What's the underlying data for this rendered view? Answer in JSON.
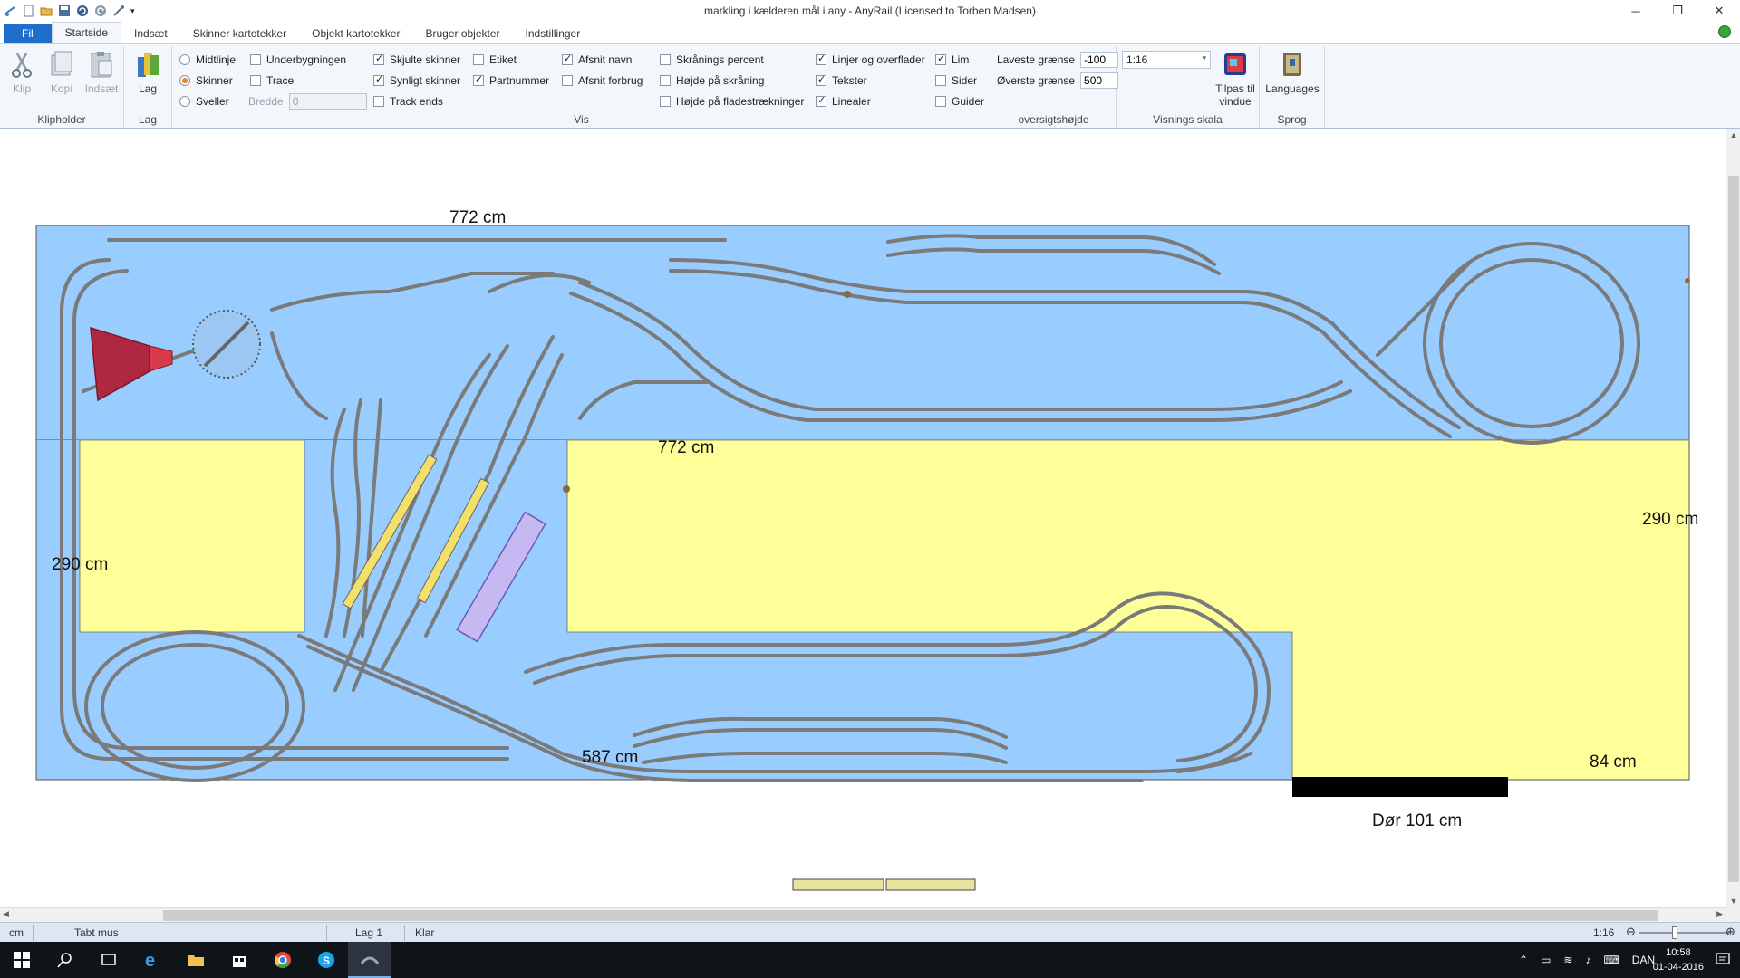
{
  "window": {
    "title": "markling i kælderen mål i.any - AnyRail (Licensed to Torben Madsen)",
    "minimize": "─",
    "maximize": "❐",
    "close": "✕"
  },
  "tabs": [
    "Fil",
    "Startside",
    "Indsæt",
    "Skinner kartotekker",
    "Objekt kartotekker",
    "Bruger objekter",
    "Indstillinger"
  ],
  "ribbon": {
    "clipboard": {
      "label": "Klipholder",
      "cut": "Klip",
      "copy": "Kopi",
      "paste": "Indsæt"
    },
    "layer": {
      "label": "Lag",
      "button": "Lag"
    },
    "view": {
      "label": "Vis",
      "col1": {
        "midtlinje": "Midtlinje",
        "skinner": "Skinner",
        "sveller": "Sveller"
      },
      "col2": {
        "underbygningen": "Underbygningen",
        "trace": "Trace",
        "bredde_label": "Bredde",
        "bredde_value": "0"
      },
      "col3": {
        "skjulte": "Skjulte skinner",
        "synligt": "Synligt skinner",
        "trackends": "Track ends"
      },
      "col4": {
        "etiket": "Etiket",
        "partnummer": "Partnummer"
      },
      "col5": {
        "afsnitnavn": "Afsnit navn",
        "afsnitforbrug": "Afsnit forbrug"
      },
      "col6": {
        "skraning": "Skrånings percent",
        "hojdeskraning": "Højde på skråning",
        "hojdeflade": "Højde på fladestrækninger"
      },
      "col7": {
        "linjer": "Linjer og overflader",
        "tekster": "Tekster",
        "linealer": "Linealer"
      },
      "col8": {
        "lim": "Lim",
        "sider": "Sider",
        "guider": "Guider"
      }
    },
    "height": {
      "label": "oversigtshøjde",
      "low_label": "Laveste grænse",
      "low_value": "-100",
      "high_label": "Øverste grænse",
      "high_value": "500"
    },
    "scale": {
      "label": "Visnings skala",
      "value": "1:16",
      "fit_line1": "Tilpas til",
      "fit_line2": "vindue"
    },
    "language": {
      "label": "Sprog",
      "button": "Languages"
    }
  },
  "layout_labels": {
    "top_width": "772 cm",
    "mid_width": "772 cm",
    "left_height": "290 cm",
    "right_height": "290 cm",
    "bottom_width": "587 cm",
    "corner_width": "84 cm",
    "door": "Dør 101 cm"
  },
  "statusbar": {
    "unit": "cm",
    "mouse": "Tabt mus",
    "layer": "Lag 1",
    "state": "Klar",
    "scale": "1:16"
  },
  "taskbar": {
    "language": "DAN",
    "time": "10:58",
    "date": "01-04-2016"
  },
  "colors": {
    "baseboard_blue": "#99ccff",
    "room_yellow": "#ffff99",
    "track_gray": "#7a7a7a",
    "accent_blue": "#1e6fc9"
  }
}
